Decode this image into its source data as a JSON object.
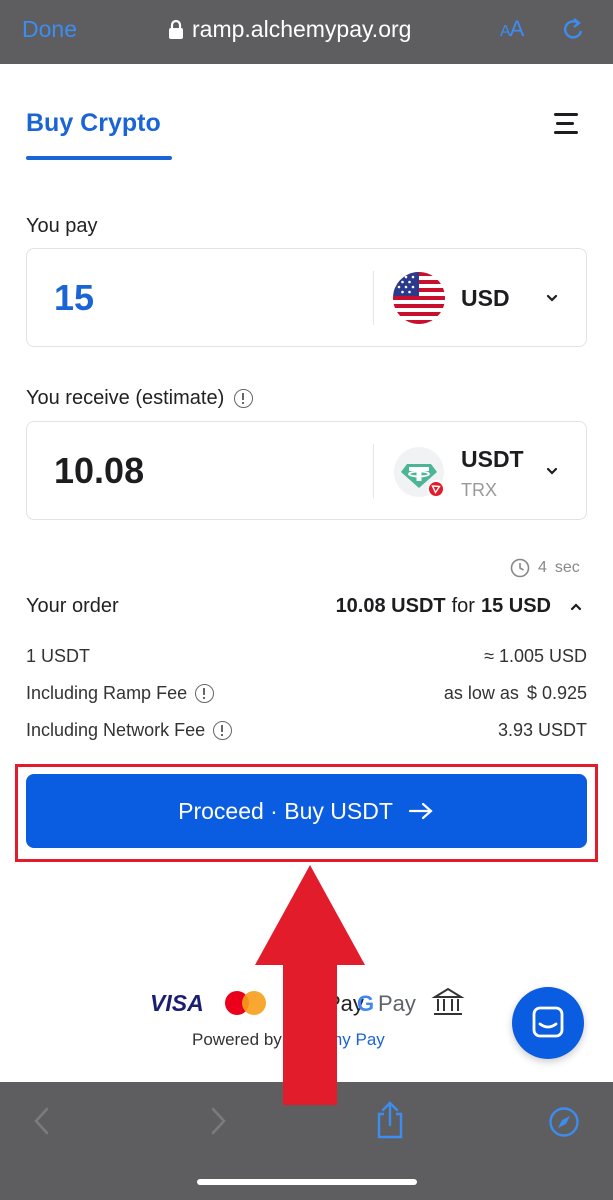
{
  "browser": {
    "done_label": "Done",
    "url": "ramp.alchemypay.org",
    "text_size_label_small": "A",
    "text_size_label_large": "A",
    "icons": [
      "lock-icon",
      "reload-icon",
      "back-icon",
      "forward-icon",
      "share-icon",
      "compass-icon"
    ]
  },
  "header": {
    "tab_label": "Buy Crypto",
    "accent_color": "#1a64d6"
  },
  "pay": {
    "label": "You pay",
    "amount": "15",
    "currency": "USD"
  },
  "receive": {
    "label": "You receive (estimate)",
    "amount": "10.08",
    "currency": "USDT",
    "network": "TRX"
  },
  "quote_timer": {
    "value": "4",
    "unit": "sec"
  },
  "order": {
    "title": "Your order",
    "receive_amount": "10.08 USDT",
    "for_word": "for",
    "pay_amount": "15 USD",
    "rate_label": "1 USDT",
    "rate_value": "≈ 1.005 USD",
    "ramp_fee_label": "Including Ramp Fee",
    "ramp_fee_prefix": "as low as",
    "ramp_fee_value": "$ 0.925",
    "network_fee_label": "Including Network Fee",
    "network_fee_value": "3.93 USDT"
  },
  "proceed_button": {
    "label": "Proceed · Buy USDT",
    "color": "#0a5ce0"
  },
  "footer": {
    "visa_label": "VISA",
    "pay_label_partial": "Pay",
    "gpay_g": "G",
    "gpay_label": "Pay",
    "powered_prefix": "Powered by",
    "powered_brand_a": "Alchemy",
    "powered_brand_b": "Pay"
  },
  "annotation": {
    "highlight_color": "#e31c2b"
  }
}
